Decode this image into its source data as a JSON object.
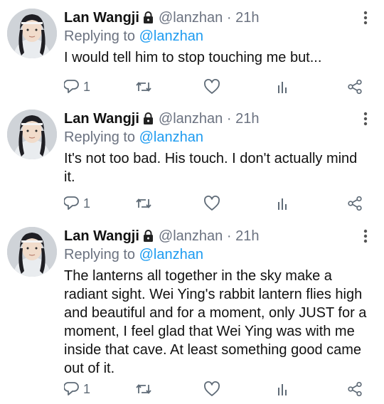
{
  "tweets": [
    {
      "author": "Lan Wangji",
      "handle": "@lanzhan",
      "time": "21h",
      "replying_prefix": "Replying to",
      "replying_to": "@lanzhan",
      "text": "I would tell him to stop touching me but...",
      "reply_count": "1"
    },
    {
      "author": "Lan Wangji",
      "handle": "@lanzhan",
      "time": "21h",
      "replying_prefix": "Replying to",
      "replying_to": "@lanzhan",
      "text": "It's not too bad. His touch. I don't actually mind it.",
      "reply_count": "1"
    },
    {
      "author": "Lan Wangji",
      "handle": "@lanzhan",
      "time": "21h",
      "replying_prefix": "Replying to",
      "replying_to": "@lanzhan",
      "text": "The lanterns all together in the sky make a radiant sight. Wei Ying's rabbit lantern flies high and beautiful and for a moment, only JUST for a moment, I feel glad that Wei Ying was with me inside that cave. At least something good came out of it.",
      "reply_count": "1"
    }
  ],
  "separator": "·",
  "icons": {
    "lock": "lock-icon",
    "more": "more-vertical-icon",
    "reply": "reply-bubble-icon",
    "retweet": "retweet-icon",
    "like": "heart-icon",
    "analytics": "bar-chart-icon",
    "share": "share-icon"
  },
  "colors": {
    "link": "#1d9bf0",
    "muted": "#6b7280",
    "text": "#111111"
  }
}
